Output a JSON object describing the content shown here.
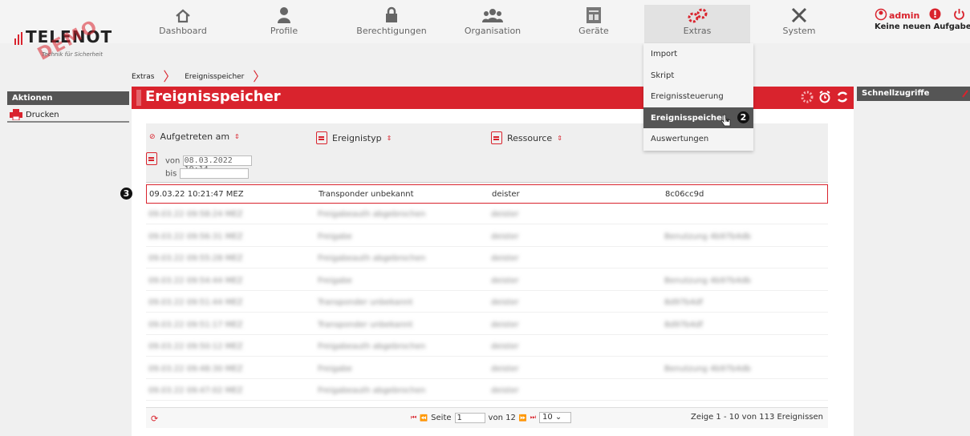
{
  "logo": {
    "brand": "TELENOT",
    "tagline": "Technik für Sicherheit",
    "watermark": "DEMO"
  },
  "nav": [
    {
      "label": "Dashboard",
      "icon": "home-icon"
    },
    {
      "label": "Profile",
      "icon": "profile-icon"
    },
    {
      "label": "Berechtigungen",
      "icon": "lock-icon"
    },
    {
      "label": "Organisation",
      "icon": "group-icon"
    },
    {
      "label": "Geräte",
      "icon": "device-icon"
    },
    {
      "label": "Extras",
      "icon": "gears-icon"
    },
    {
      "label": "System",
      "icon": "tools-icon"
    }
  ],
  "user": {
    "name": "admin",
    "tasks": "Keine neuen Aufgaben"
  },
  "breadcrumb": {
    "items": [
      "Extras",
      "Ereignisspeicher"
    ]
  },
  "left_sidebar": {
    "title": "Aktionen",
    "items": [
      {
        "label": "Drucken"
      }
    ]
  },
  "right_sidebar": {
    "title": "Schnellzugriffe"
  },
  "page": {
    "title": "Ereignisspeicher"
  },
  "table": {
    "columns": [
      "Aufgetreten am",
      "Ereignistyp",
      "Ressource"
    ],
    "filter": {
      "from_label": "von",
      "from_value": "08.03.2022 10:14",
      "to_label": "bis",
      "to_value": ""
    },
    "highlighted_row": {
      "date": "09.03.22 10:21:47 MEZ",
      "type": "Transponder unbekannt",
      "resource": "deister",
      "extra": "8c06cc9d"
    },
    "blurred_rows": [
      {
        "date": "09.03.22 09:58:24 MEZ",
        "type": "Freigabeauth abgebrochen",
        "resource": "deister",
        "extra": ""
      },
      {
        "date": "09.03.22 09:56:31 MEZ",
        "type": "Freigabe",
        "resource": "deister",
        "extra": "Benutzung 4b97b4db"
      },
      {
        "date": "09.03.22 09:55:28 MEZ",
        "type": "Freigabeauth abgebrochen",
        "resource": "deister",
        "extra": ""
      },
      {
        "date": "09.03.22 09:54:44 MEZ",
        "type": "Freigabe",
        "resource": "deister",
        "extra": "Benutzung 4b97b4db"
      },
      {
        "date": "09.03.22 09:51:44 MEZ",
        "type": "Transponder unbekannt",
        "resource": "deister",
        "extra": "8d97b4df"
      },
      {
        "date": "09.03.22 09:51:17 MEZ",
        "type": "Transponder unbekannt",
        "resource": "deister",
        "extra": "8d97b4df"
      },
      {
        "date": "09.03.22 09:50:12 MEZ",
        "type": "Freigabeauth abgebrochen",
        "resource": "deister",
        "extra": ""
      },
      {
        "date": "09.03.22 09:48:30 MEZ",
        "type": "Freigabe",
        "resource": "deister",
        "extra": "Benutzung 4b97b4db"
      },
      {
        "date": "09.03.22 09:47:02 MEZ",
        "type": "Freigabeauth abgebrochen",
        "resource": "deister",
        "extra": ""
      }
    ]
  },
  "pager": {
    "page_label": "Seite",
    "page_value": "1",
    "of_label": "von 12",
    "page_size": "10",
    "summary": "Zeige 1 - 10 von 113 Ereignissen"
  },
  "extras_menu": [
    {
      "label": "Import"
    },
    {
      "label": "Skript"
    },
    {
      "label": "Ereignissteuerung"
    },
    {
      "label": "Ereignisspeicher"
    },
    {
      "label": "Auswertungen"
    }
  ],
  "markers": {
    "menu": "2",
    "row": "3"
  },
  "colors": {
    "accent": "#d9232d",
    "header_gray": "#555555"
  }
}
